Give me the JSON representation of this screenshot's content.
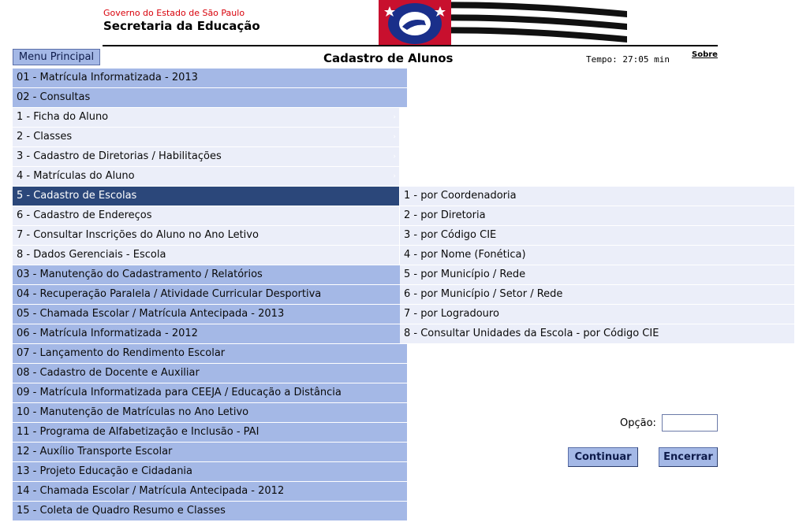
{
  "header": {
    "government": "Governo do Estado de São Paulo",
    "secretariat": "Secretaria da Educação",
    "logo": "são-paulo-state-flag-logo"
  },
  "toolbar": {
    "menu_principal": "Menu Principal",
    "title": "Cadastro de Alunos",
    "timer_label": "Tempo:",
    "timer_value": "27:05 min",
    "sobre": "Sobre"
  },
  "menu": {
    "items": [
      {
        "label": "01 - Matrícula Informatizada - 2013",
        "level": "top"
      },
      {
        "label": "02 - Consultas",
        "level": "top"
      },
      {
        "label": "1 - Ficha do Aluno",
        "level": "sub",
        "has_submenu": true
      },
      {
        "label": "2 - Classes",
        "level": "sub",
        "has_submenu": true
      },
      {
        "label": "3 - Cadastro de Diretorias / Habilitações",
        "level": "sub",
        "has_submenu": true
      },
      {
        "label": "4 - Matrículas do Aluno",
        "level": "sub",
        "has_submenu": true
      },
      {
        "label": "5 - Cadastro de Escolas",
        "level": "sub",
        "active": true
      },
      {
        "label": "6 - Cadastro de Endereços",
        "level": "sub"
      },
      {
        "label": "7 - Consultar Inscrições do Aluno no Ano Letivo",
        "level": "sub"
      },
      {
        "label": "8 - Dados Gerenciais - Escola",
        "level": "sub"
      },
      {
        "label": "03 - Manutenção do Cadastramento / Relatórios",
        "level": "top"
      },
      {
        "label": "04 - Recuperação Paralela / Atividade Curricular Desportiva",
        "level": "top"
      },
      {
        "label": "05 - Chamada Escolar / Matrícula Antecipada - 2013",
        "level": "top"
      },
      {
        "label": "06 - Matrícula Informatizada - 2012",
        "level": "top"
      },
      {
        "label": "07 - Lançamento do Rendimento Escolar",
        "level": "top"
      },
      {
        "label": "08 - Cadastro de Docente e Auxiliar",
        "level": "top"
      },
      {
        "label": "09 - Matrícula Informatizada para CEEJA / Educação a Distância",
        "level": "top"
      },
      {
        "label": "10 - Manutenção de Matrículas no Ano Letivo",
        "level": "top"
      },
      {
        "label": "11 - Programa de Alfabetização e Inclusão - PAI",
        "level": "top"
      },
      {
        "label": "12 - Auxílio Transporte Escolar",
        "level": "top"
      },
      {
        "label": "13 - Projeto Educação e Cidadania",
        "level": "top"
      },
      {
        "label": "14 - Chamada Escolar / Matrícula Antecipada - 2012",
        "level": "top"
      },
      {
        "label": "15 - Coleta de Quadro Resumo e Classes",
        "level": "top"
      }
    ],
    "arrow_glyph": "›"
  },
  "flyout": {
    "items": [
      "1 - por Coordenadoria",
      "2 - por Diretoria",
      "3 - por Código CIE",
      "4 - por Nome (Fonética)",
      "5 - por Município / Rede",
      "6 - por Município / Setor / Rede",
      "7 - por Logradouro",
      "8 - Consultar Unidades da Escola - por Código CIE"
    ]
  },
  "form": {
    "opcao_label": "Opção:",
    "opcao_value": "",
    "continuar": "Continuar",
    "encerrar": "Encerrar"
  },
  "colors": {
    "menu_top": "#a4b8e6",
    "menu_sub": "#ebeef9",
    "menu_active": "#2b477a",
    "gov_red": "#d8000a"
  }
}
